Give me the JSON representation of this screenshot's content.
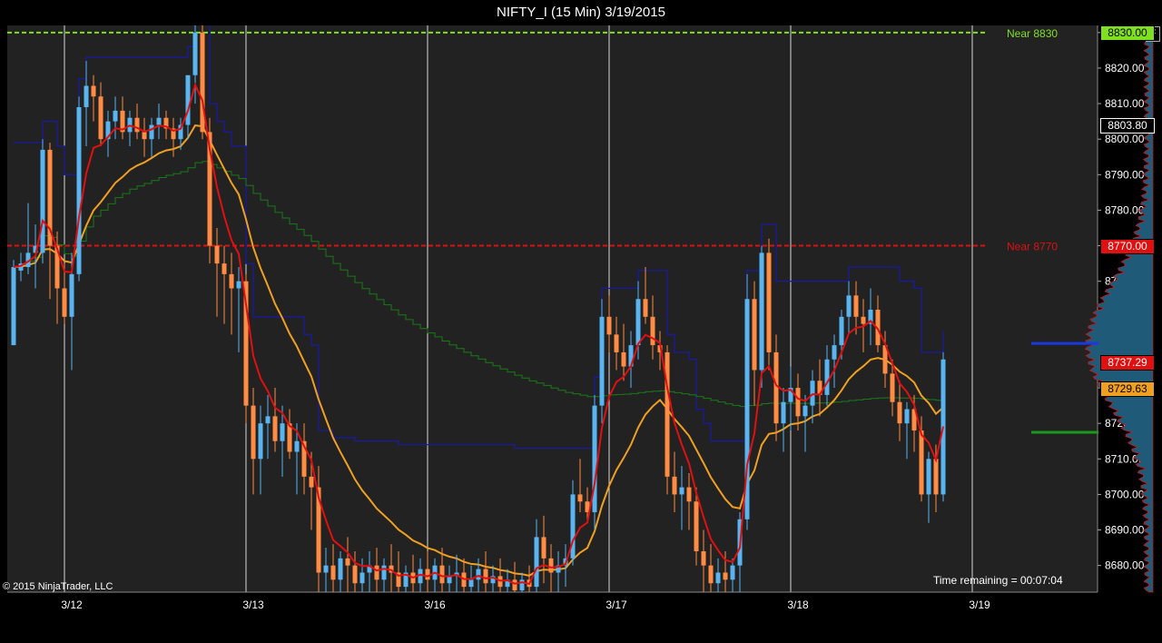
{
  "window": {
    "title": "NIFTY_I (15 Min)  3/19/2015",
    "f_button": "F"
  },
  "footer": {
    "copyright": "© 2015 NinjaTrader, LLC",
    "time_remaining": "Time remaining = 00:07:04"
  },
  "colors": {
    "background": "#222222",
    "up_candle": "#5ab4f0",
    "down_candle": "#ff8c42",
    "fast_ma": "#e01010",
    "slow_ma": "#f0a020",
    "vwap": "#1a7a1a",
    "stop_line": "#1a1aa0",
    "near_high": "#7fe01f",
    "near_low": "#e01010"
  },
  "chart_data": {
    "type": "candlestick",
    "title": "NIFTY_I (15 Min)  3/19/2015",
    "ylim": [
      8672.5,
      8832
    ],
    "y_ticks": [
      8680,
      8690,
      8700,
      8710,
      8720,
      8730,
      8740,
      8750,
      8760,
      8770,
      8780,
      8790,
      8800,
      8810,
      8820,
      8830
    ],
    "y_tick_labels": [
      "8680.00",
      "8690.00",
      "8700.00",
      "8710.00",
      "8720.00",
      "8730.00",
      "8740.00",
      "8750.00",
      "8760.00",
      "8770.00",
      "8780.00",
      "8790.00",
      "8800.00",
      "8810.00",
      "8820.00",
      "8830.00"
    ],
    "x_ticks": [
      "3/12",
      "3/13",
      "3/16",
      "3/17",
      "3/18",
      "3/19"
    ],
    "session_dividers": [
      {
        "label": "3/12",
        "bar": 0
      },
      {
        "label": "3/13",
        "bar": 25
      },
      {
        "label": "3/16",
        "bar": 50
      },
      {
        "label": "3/17",
        "bar": 75
      },
      {
        "label": "3/18",
        "bar": 100
      },
      {
        "label": "3/19",
        "bar": 125
      }
    ],
    "bar_count": 128,
    "candles": [
      [
        8742,
        8766,
        8745,
        8764
      ],
      [
        8763,
        8768,
        8760,
        8765
      ],
      [
        8764,
        8782,
        8762,
        8768
      ],
      [
        8768,
        8776,
        8758,
        8770
      ],
      [
        8768,
        8800,
        8765,
        8797
      ],
      [
        8797,
        8799,
        8755,
        8770
      ],
      [
        8770,
        8774,
        8748,
        8758
      ],
      [
        8758,
        8765,
        8748,
        8750
      ],
      [
        8750,
        8768,
        8735,
        8762
      ],
      [
        8762,
        8812,
        8760,
        8809
      ],
      [
        8809,
        8822,
        8798,
        8815
      ],
      [
        8815,
        8818,
        8805,
        8812
      ],
      [
        8812,
        8816,
        8798,
        8800
      ],
      [
        8800,
        8808,
        8795,
        8805
      ],
      [
        8805,
        8812,
        8800,
        8808
      ],
      [
        8808,
        8812,
        8800,
        8802
      ],
      [
        8802,
        8808,
        8798,
        8806
      ],
      [
        8806,
        8810,
        8800,
        8802
      ],
      [
        8802,
        8806,
        8795,
        8800
      ],
      [
        8800,
        8806,
        8795,
        8804
      ],
      [
        8804,
        8810,
        8800,
        8806
      ],
      [
        8806,
        8808,
        8800,
        8803
      ],
      [
        8803,
        8806,
        8795,
        8800
      ],
      [
        8800,
        8806,
        8797,
        8804
      ],
      [
        8804,
        8814,
        8800,
        8818
      ],
      [
        8818,
        8832,
        8810,
        8830
      ],
      [
        8830,
        8834,
        8800,
        8802
      ],
      [
        8802,
        8806,
        8765,
        8770
      ],
      [
        8770,
        8775,
        8750,
        8765
      ],
      [
        8765,
        8770,
        8748,
        8762
      ],
      [
        8762,
        8768,
        8745,
        8758
      ],
      [
        8758,
        8764,
        8740,
        8760
      ],
      [
        8760,
        8762,
        8720,
        8725
      ],
      [
        8725,
        8730,
        8700,
        8710
      ],
      [
        8710,
        8725,
        8700,
        8720
      ],
      [
        8720,
        8728,
        8710,
        8722
      ],
      [
        8722,
        8730,
        8712,
        8715
      ],
      [
        8715,
        8725,
        8705,
        8720
      ],
      [
        8720,
        8724,
        8710,
        8712
      ],
      [
        8712,
        8720,
        8700,
        8715
      ],
      [
        8715,
        8720,
        8700,
        8705
      ],
      [
        8705,
        8712,
        8690,
        8702
      ],
      [
        8702,
        8708,
        8672,
        8678
      ],
      [
        8678,
        8685,
        8672,
        8680
      ],
      [
        8680,
        8686,
        8672,
        8676
      ],
      [
        8676,
        8684,
        8672,
        8682
      ],
      [
        8682,
        8688,
        8672,
        8680
      ],
      [
        8680,
        8684,
        8672,
        8675
      ],
      [
        8675,
        8682,
        8672,
        8678
      ],
      [
        8678,
        8684,
        8672,
        8680
      ],
      [
        8680,
        8685,
        8672,
        8676
      ],
      [
        8676,
        8682,
        8672,
        8680
      ],
      [
        8680,
        8686,
        8672,
        8678
      ],
      [
        8678,
        8684,
        8672,
        8674
      ],
      [
        8674,
        8680,
        8672,
        8678
      ],
      [
        8678,
        8683,
        8672,
        8675
      ],
      [
        8675,
        8682,
        8672,
        8679
      ],
      [
        8679,
        8684,
        8672,
        8676
      ],
      [
        8676,
        8682,
        8672,
        8680
      ],
      [
        8680,
        8685,
        8672,
        8675
      ],
      [
        8675,
        8680,
        8672,
        8677
      ],
      [
        8677,
        8683,
        8672,
        8678
      ],
      [
        8678,
        8682,
        8672,
        8674
      ],
      [
        8674,
        8680,
        8672,
        8676
      ],
      [
        8676,
        8682,
        8672,
        8679
      ],
      [
        8679,
        8684,
        8672,
        8675
      ],
      [
        8675,
        8680,
        8672,
        8677
      ],
      [
        8677,
        8682,
        8672,
        8674
      ],
      [
        8674,
        8679,
        8672,
        8676
      ],
      [
        8676,
        8681,
        8672,
        8673
      ],
      [
        8673,
        8678,
        8672,
        8676
      ],
      [
        8676,
        8680,
        8672,
        8674
      ],
      [
        8674,
        8693,
        8672,
        8688
      ],
      [
        8688,
        8694,
        8675,
        8682
      ],
      [
        8682,
        8686,
        8672,
        8678
      ],
      [
        8678,
        8684,
        8672,
        8680
      ],
      [
        8680,
        8686,
        8674,
        8682
      ],
      [
        8682,
        8704,
        8680,
        8700
      ],
      [
        8700,
        8710,
        8695,
        8698
      ],
      [
        8698,
        8702,
        8692,
        8695
      ],
      [
        8695,
        8728,
        8690,
        8725
      ],
      [
        8725,
        8755,
        8720,
        8750
      ],
      [
        8750,
        8756,
        8740,
        8745
      ],
      [
        8745,
        8750,
        8735,
        8740
      ],
      [
        8740,
        8748,
        8732,
        8736
      ],
      [
        8736,
        8746,
        8730,
        8742
      ],
      [
        8742,
        8760,
        8738,
        8755
      ],
      [
        8755,
        8764,
        8748,
        8750
      ],
      [
        8750,
        8756,
        8738,
        8742
      ],
      [
        8742,
        8746,
        8735,
        8740
      ],
      [
        8740,
        8742,
        8700,
        8705
      ],
      [
        8705,
        8712,
        8695,
        8700
      ],
      [
        8700,
        8708,
        8690,
        8702
      ],
      [
        8702,
        8706,
        8690,
        8698
      ],
      [
        8698,
        8702,
        8680,
        8684
      ],
      [
        8684,
        8690,
        8672,
        8680
      ],
      [
        8680,
        8686,
        8672,
        8675
      ],
      [
        8675,
        8682,
        8672,
        8678
      ],
      [
        8678,
        8684,
        8672,
        8676
      ],
      [
        8676,
        8682,
        8672,
        8680
      ],
      [
        8680,
        8695,
        8672,
        8693
      ],
      [
        8693,
        8762,
        8690,
        8755
      ],
      [
        8755,
        8760,
        8725,
        8735
      ],
      [
        8735,
        8770,
        8730,
        8768
      ],
      [
        8768,
        8772,
        8735,
        8740
      ],
      [
        8740,
        8745,
        8715,
        8720
      ],
      [
        8720,
        8730,
        8712,
        8726
      ],
      [
        8726,
        8736,
        8718,
        8730
      ],
      [
        8730,
        8734,
        8718,
        8722
      ],
      [
        8722,
        8728,
        8712,
        8725
      ],
      [
        8725,
        8735,
        8720,
        8732
      ],
      [
        8732,
        8738,
        8722,
        8728
      ],
      [
        8728,
        8742,
        8725,
        8738
      ],
      [
        8738,
        8745,
        8730,
        8742
      ],
      [
        8742,
        8752,
        8738,
        8750
      ],
      [
        8750,
        8760,
        8745,
        8756
      ],
      [
        8756,
        8760,
        8745,
        8750
      ],
      [
        8750,
        8755,
        8740,
        8748
      ],
      [
        8748,
        8758,
        8742,
        8752
      ],
      [
        8752,
        8756,
        8740,
        8742
      ],
      [
        8742,
        8746,
        8730,
        8734
      ],
      [
        8734,
        8738,
        8722,
        8726
      ],
      [
        8726,
        8732,
        8715,
        8720
      ],
      [
        8720,
        8726,
        8710,
        8724
      ],
      [
        8724,
        8728,
        8712,
        8718
      ],
      [
        8718,
        8722,
        8698,
        8700
      ],
      [
        8700,
        8712,
        8692,
        8710
      ],
      [
        8710,
        8714,
        8695,
        8700
      ],
      [
        8700,
        8740,
        8698,
        8738
      ]
    ],
    "series": [
      {
        "name": "",
        "kind": "fast_ma"
      },
      {
        "name": "",
        "kind": "slow_ma"
      },
      {
        "name": "",
        "kind": "vwap"
      },
      {
        "name": "",
        "kind": "trailing_stop"
      }
    ],
    "levels": [
      {
        "label": "Near 8830",
        "value": 8830,
        "color": "#7fe01f",
        "tag": "8830.00"
      },
      {
        "label": "Near 8770",
        "value": 8770,
        "color": "#e01010",
        "tag": "8770.00"
      }
    ],
    "price_tags": [
      {
        "value": 8803.8,
        "text": "8803.80",
        "bg": "#000000",
        "fg": "#ffffff",
        "border": "#ffffff"
      },
      {
        "value": 8737.29,
        "text": "8737.29",
        "bg": "#e01010",
        "fg": "#ffffff",
        "border": "#000000"
      },
      {
        "value": 8729.63,
        "text": "8729.63",
        "bg": "#f0a020",
        "fg": "#000000",
        "border": "#000000"
      }
    ],
    "volume_profile_markers": [
      {
        "value": 8742.5,
        "color": "#1a3ae0"
      },
      {
        "value": 8717.5,
        "color": "#1a9a1a"
      }
    ],
    "last_price": 8803.8
  }
}
